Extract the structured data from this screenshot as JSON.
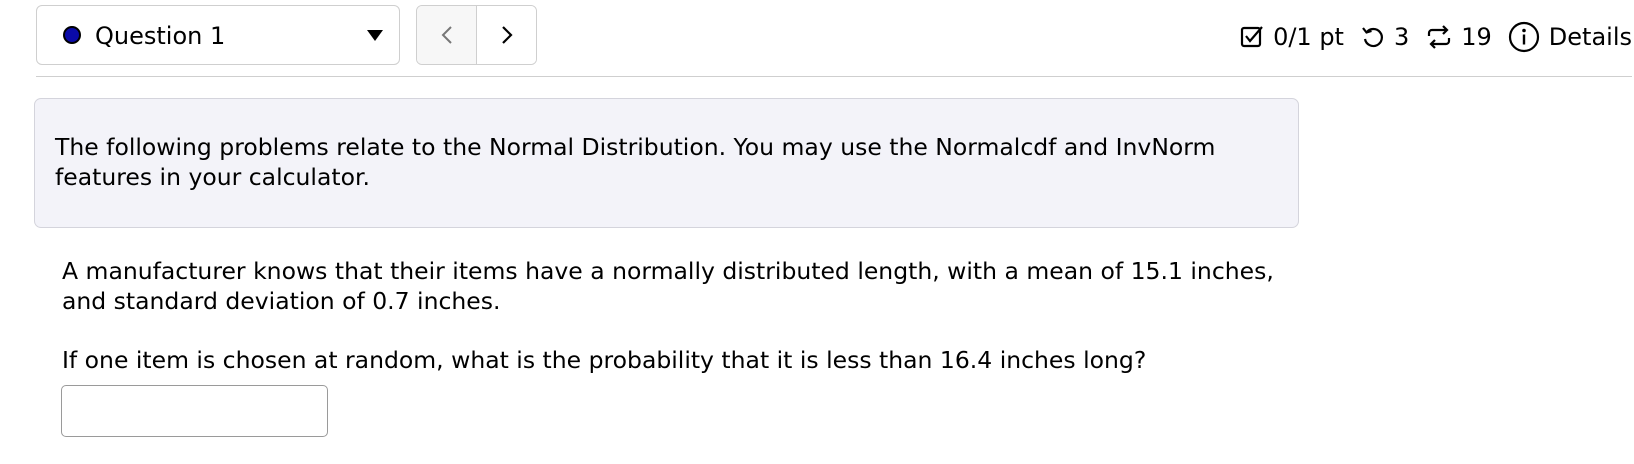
{
  "question_select": {
    "label": "Question 1",
    "status_color": "#0a0aa8"
  },
  "nav": {
    "prev_icon": "chevron-left-icon",
    "next_icon": "chevron-right-icon"
  },
  "meta": {
    "score": "0/1 pt",
    "retries": "3",
    "attempts": "19",
    "details_label": "Details"
  },
  "instructions": {
    "text": "The following problems relate to the Normal Distribution. You may use the Normalcdf and InvNorm features in your calculator."
  },
  "problem": {
    "statement": "A manufacturer knows that their items have a normally distributed length, with a mean of 15.1 inches, and standard deviation of 0.7 inches.",
    "question": "If one item is chosen at random, what is the probability that it is less than 16.4 inches long?",
    "answer_value": ""
  }
}
